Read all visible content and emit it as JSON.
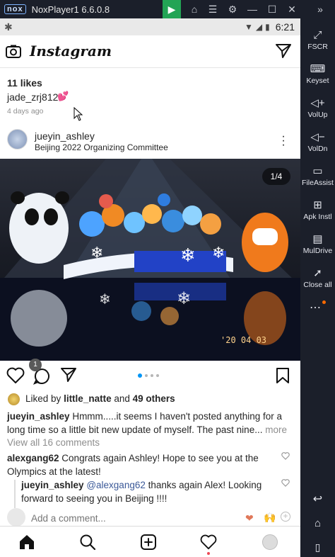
{
  "emulator": {
    "logo_text": "nox",
    "title": "NoxPlayer1 6.6.0.8",
    "side_tools": [
      {
        "label": "FSCR",
        "icon": "fullscreen-icon"
      },
      {
        "label": "Keyset",
        "icon": "keyboard-icon"
      },
      {
        "label": "VolUp",
        "icon": "volume-up-icon"
      },
      {
        "label": "VolDn",
        "icon": "volume-down-icon"
      },
      {
        "label": "FileAssist",
        "icon": "file-assistant-icon"
      },
      {
        "label": "Apk Instl",
        "icon": "apk-install-icon"
      },
      {
        "label": "MulDrive",
        "icon": "multi-drive-icon"
      },
      {
        "label": "Close all",
        "icon": "rocket-icon"
      }
    ]
  },
  "status_bar": {
    "time": "6:21"
  },
  "instagram": {
    "logo": "Instagram",
    "previous_post": {
      "likes": "11 likes",
      "caption_user": "jade_zrj812",
      "time": "4 days ago"
    },
    "post": {
      "username": "jueyin_ashley",
      "location": "Beijing 2022 Organizing Committee",
      "counter": "1/4",
      "date_stamp": "'20 04 03",
      "liked_by_prefix": "Liked by",
      "liked_by_user": "little_natte",
      "liked_by_and": "and",
      "liked_by_others": "49 others",
      "caption_user": "jueyin_ashley",
      "caption_text": " Hmmm.....it seems I haven't posted anything for a long time so a little bit new update of myself. The past nine...",
      "more": " more",
      "view_comments": "View all 16 comments",
      "comments": [
        {
          "user": "alexgang62",
          "text": " Congrats again Ashley! Hope to see you at the Olympics at the latest!"
        },
        {
          "user": "jueyin_ashley",
          "mention": "@alexgang62",
          "text": " thanks again Alex!  Looking forward to seeing you in Beijing !!!!"
        }
      ],
      "add_comment_placeholder": "Add a comment..."
    }
  },
  "colors": {
    "link": "#3b5998",
    "accent": "#0095f6",
    "nox_green": "#23a455"
  }
}
